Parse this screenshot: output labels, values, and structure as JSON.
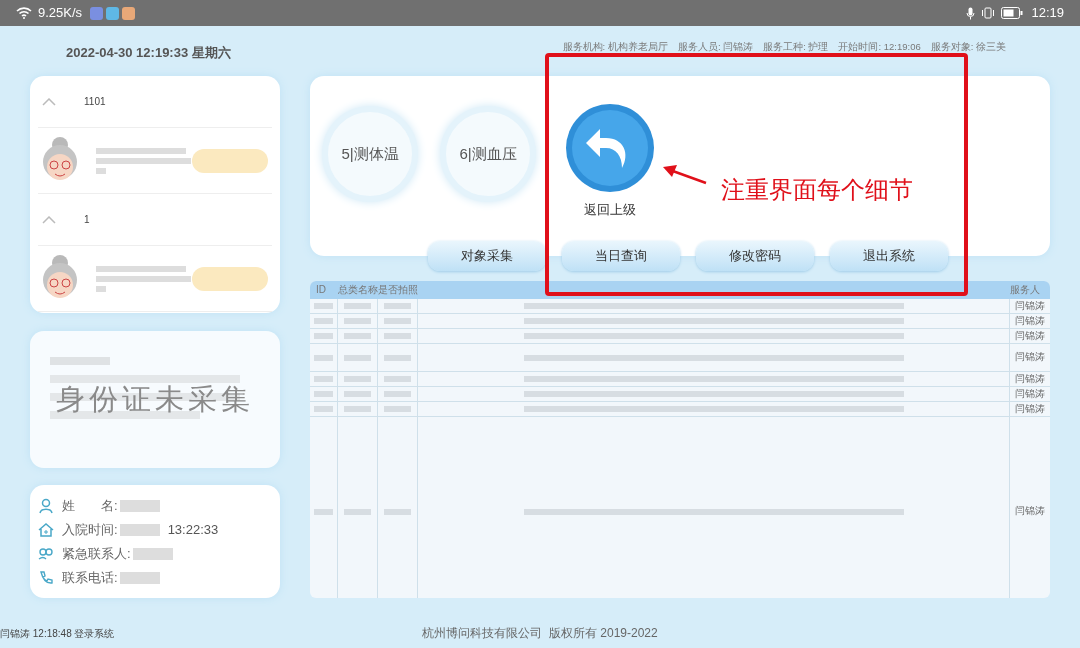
{
  "status_bar": {
    "speed": "9.25K/s",
    "time": "12:19"
  },
  "header": {
    "datetime": "2022-04-30 12:19:33 星期六",
    "info": [
      {
        "label": "服务机构:",
        "value": "机构养老局厅"
      },
      {
        "label": "服务人员:",
        "value": "闫锦涛"
      },
      {
        "label": "服务工种:",
        "value": "护理"
      },
      {
        "label": "开始时间:",
        "value": "12:19:06"
      },
      {
        "label": "服务对象:",
        "value": "徐三美"
      }
    ]
  },
  "rooms": [
    {
      "number": "1101",
      "expanded": true
    },
    {
      "number": "1",
      "expanded": true
    }
  ],
  "id_card": {
    "message": "身份证未采集"
  },
  "resident": [
    {
      "kind": "person",
      "label": "姓　　名:"
    },
    {
      "kind": "home",
      "label": "入院时间:",
      "value": "13:22:33"
    },
    {
      "kind": "contact",
      "label": "紧急联系人:"
    },
    {
      "kind": "phone",
      "label": "联系电话:"
    }
  ],
  "functions": [
    {
      "label": "5|测体温"
    },
    {
      "label": "6|测血压"
    }
  ],
  "return_button": {
    "label": "返回上级"
  },
  "buttons": [
    {
      "label": "对象采集"
    },
    {
      "label": "当日查询"
    },
    {
      "label": "修改密码"
    },
    {
      "label": "退出系统"
    }
  ],
  "table": {
    "columns": [
      "ID",
      "总类名称",
      "是否拍照",
      "服务人"
    ],
    "rows": [
      {
        "kind": "single",
        "staff": "闫锦涛"
      },
      {
        "kind": "single",
        "staff": "闫锦涛"
      },
      {
        "kind": "single",
        "staff": "闫锦涛"
      },
      {
        "kind": "double",
        "staff": "闫锦涛"
      },
      {
        "kind": "single",
        "staff": "闫锦涛"
      },
      {
        "kind": "single",
        "staff": "闫锦涛"
      },
      {
        "kind": "single",
        "staff": "闫锦涛"
      },
      {
        "kind": "long",
        "staff": "闫锦涛"
      }
    ]
  },
  "login_log": "闫锦涛 12:18:48 登录系统",
  "footer": "杭州博问科技有限公司  版权所有 2019-2022",
  "annotation": {
    "text": "注重界面每个细节"
  }
}
